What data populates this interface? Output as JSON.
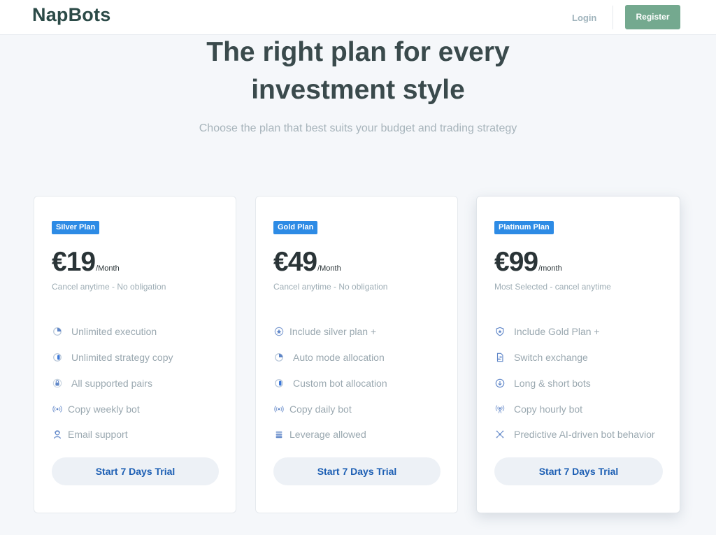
{
  "header": {
    "logo": "NapBots",
    "login_label": "Login",
    "register_label": "Register"
  },
  "hero": {
    "title_line1": "The right plan for every",
    "title_line2": "investment style",
    "subtitle": "Choose the plan that best suits your budget and trading strategy"
  },
  "colors": {
    "brand_green": "#74a98f",
    "badge_blue": "#2d8be5",
    "cta_text": "#1d5fb4",
    "feature_icon": "#6d8fc9"
  },
  "plans": [
    {
      "badge": "Silver Plan",
      "price": "€19",
      "period": "/Month",
      "note": "Cancel anytime - No obligation",
      "features": [
        {
          "icon": "pie-chart-icon",
          "label": "Unlimited execution"
        },
        {
          "icon": "toggle-icon",
          "label": "Unlimited strategy copy"
        },
        {
          "icon": "lock-icon",
          "label": "All supported pairs"
        },
        {
          "icon": "broadcast-icon",
          "label": "Copy weekly bot"
        },
        {
          "icon": "support-agent-icon",
          "label": "Email support"
        }
      ],
      "cta": "Start 7 Days Trial"
    },
    {
      "badge": "Gold Plan",
      "price": "€49",
      "period": "/Month",
      "note": "Cancel anytime - No obligation",
      "features": [
        {
          "icon": "star-circle-icon",
          "label": "Include silver plan +"
        },
        {
          "icon": "pie-chart-icon",
          "label": "Auto mode allocation"
        },
        {
          "icon": "toggle-icon",
          "label": "Custom bot allocation"
        },
        {
          "icon": "broadcast-icon",
          "label": "Copy daily bot"
        },
        {
          "icon": "stack-icon",
          "label": "Leverage allowed"
        }
      ],
      "cta": "Start 7 Days Trial"
    },
    {
      "badge": "Platinum Plan",
      "price": "€99",
      "period": "/month",
      "note": "Most Selected - cancel anytime",
      "features": [
        {
          "icon": "shield-star-icon",
          "label": "Include Gold Plan +"
        },
        {
          "icon": "swap-document-icon",
          "label": "Switch exchange"
        },
        {
          "icon": "arrow-down-circle-icon",
          "label": "Long & short bots"
        },
        {
          "icon": "broadcast-tower-icon",
          "label": "Copy hourly bot"
        },
        {
          "icon": "ai-network-icon",
          "label": "Predictive AI-driven bot behavior"
        }
      ],
      "cta": "Start 7 Days Trial"
    }
  ]
}
